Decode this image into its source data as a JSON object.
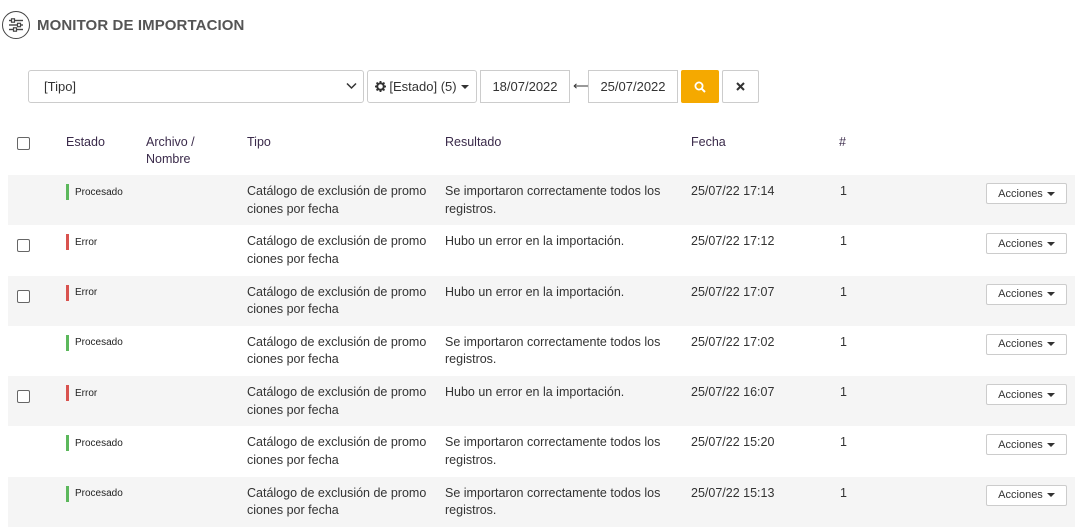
{
  "header": {
    "title": "MONITOR DE IMPORTACION",
    "icon": "sliders-icon"
  },
  "filters": {
    "tipo_value": "[Tipo]",
    "estado_label": "[Estado] (5)",
    "date_from": "18/07/2022",
    "date_to": "25/07/2022",
    "range_glyph": "⟷"
  },
  "table": {
    "columns": {
      "estado": "Estado",
      "archivo_line1": "Archivo /",
      "archivo_line2": "Nombre",
      "tipo": "Tipo",
      "resultado": "Resultado",
      "fecha": "Fecha",
      "num": "#"
    },
    "action_label": "Acciones",
    "rows": [
      {
        "checkbox": false,
        "status": "Procesado",
        "status_type": "ok",
        "tipo": "Catálogo de exclusión de promociones por fecha",
        "resultado": "Se importaron correctamente todos los registros.",
        "fecha": "25/07/22 17:14",
        "num": "1"
      },
      {
        "checkbox": true,
        "status": "Error",
        "status_type": "err",
        "tipo": "Catálogo de exclusión de promociones por fecha",
        "resultado": "Hubo un error en la importación.",
        "fecha": "25/07/22 17:12",
        "num": "1"
      },
      {
        "checkbox": true,
        "status": "Error",
        "status_type": "err",
        "tipo": "Catálogo de exclusión de promociones por fecha",
        "resultado": "Hubo un error en la importación.",
        "fecha": "25/07/22 17:07",
        "num": "1"
      },
      {
        "checkbox": false,
        "status": "Procesado",
        "status_type": "ok",
        "tipo": "Catálogo de exclusión de promociones por fecha",
        "resultado": "Se importaron correctamente todos los registros.",
        "fecha": "25/07/22 17:02",
        "num": "1"
      },
      {
        "checkbox": true,
        "status": "Error",
        "status_type": "err",
        "tipo": "Catálogo de exclusión de promociones por fecha",
        "resultado": "Hubo un error en la importación.",
        "fecha": "25/07/22 16:07",
        "num": "1"
      },
      {
        "checkbox": false,
        "status": "Procesado",
        "status_type": "ok",
        "tipo": "Catálogo de exclusión de promociones por fecha",
        "resultado": "Se importaron correctamente todos los registros.",
        "fecha": "25/07/22 15:20",
        "num": "1"
      },
      {
        "checkbox": false,
        "status": "Procesado",
        "status_type": "ok",
        "tipo": "Catálogo de exclusión de promociones por fecha",
        "resultado": "Se importaron correctamente todos los registros.",
        "fecha": "25/07/22 15:13",
        "num": "1"
      }
    ]
  },
  "colors": {
    "accent": "#f5a900",
    "ok": "#5cb85c",
    "err": "#d9534f"
  }
}
